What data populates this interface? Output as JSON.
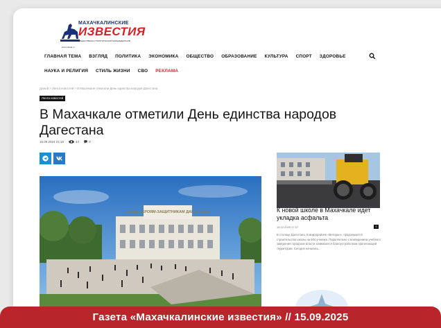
{
  "logo": {
    "line1": "МАХАЧКАЛИНСКИЕ",
    "line2": "ИЗВЕСТИЯ",
    "subtitle": "ОБЩЕСТВЕННО-ПОЛИТИЧЕСКИЙ ЕЖЕНЕДЕЛЬНИК",
    "url": "www.mkala.ru"
  },
  "nav": {
    "row1": [
      "ГЛАВНАЯ ТЕМА",
      "ВЗГЛЯД",
      "ПОЛИТИКА",
      "ЭКОНОМИКА",
      "ОБЩЕСТВО",
      "ОБРАЗОВАНИЕ",
      "КУЛЬТУРА",
      "СПОРТ",
      "ЗДОРОВЬЕ"
    ],
    "row2": [
      "НАУКА И РЕЛИГИЯ",
      "СТИЛЬ ЖИЗНИ",
      "СВО",
      "РЕКЛАМА"
    ]
  },
  "breadcrumb": "Домой  >  Лента новостей  >  В Махачкале отметили День единства народов Дагестана",
  "tag": "Лента новостей",
  "article": {
    "title": "В Махачкале отметили День единства народов Дагестана",
    "date": "15.09.2024 21:18",
    "views": "44",
    "comments": "0",
    "hero_sign": "СЛАВА ГЕРОЯМ-ЗАЩИТНИКАМ ДАГЕСТАНА!"
  },
  "sidebar": {
    "title": "К новой школе в Махачкале идет укладка асфальта",
    "date": "15.12.2025 17:07",
    "count": "0",
    "excerpt": "В столице Дагестана, в микрорайоне «Ветеран», продолжается строительство школы на 604 ученика. Параллельно с возведением учебного заведения городские власти занимаются благоустройством прилегающей территории. Сегодня начались..."
  },
  "banner": "Газета «Махачкалинские известия» // 15.09.2025",
  "colors": {
    "brand_blue": "#1b2f7a",
    "brand_red": "#d61f26",
    "banner": "#b8262b",
    "telegram": "#1d8fd0",
    "vk": "#2b78c6"
  }
}
